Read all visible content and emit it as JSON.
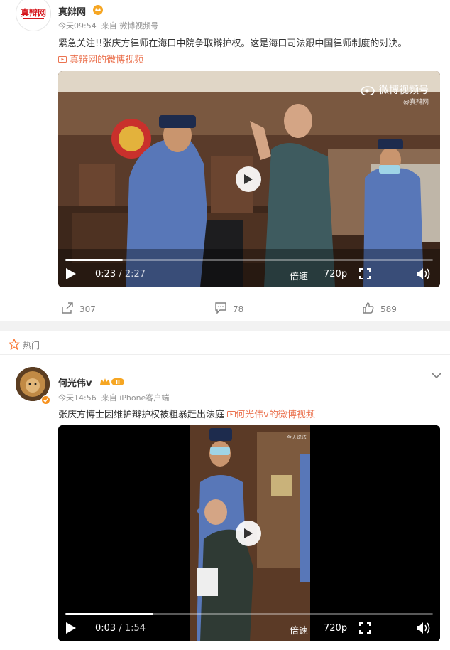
{
  "post1": {
    "author": "真辩网",
    "avatar_text": "真辩网",
    "time": "今天09:54",
    "source": "来自 微博视频号",
    "text": "紧急关注!!张庆方律师在海口中院争取辩护权。这是海口司法跟中国律师制度的对决。",
    "video_link": "真辩网的微博视频",
    "video": {
      "watermark": "微博视频号",
      "watermark_sub": "@真辩网",
      "time_current": "0:23",
      "time_total": "2:27",
      "progress": 0.156,
      "speed_label": "倍速",
      "quality_label": "720p"
    },
    "actions": {
      "repost": "307",
      "comment": "78",
      "like": "589"
    }
  },
  "post2": {
    "hot_label": "热门",
    "author": "何光伟v",
    "time": "今天14:56",
    "source": "来自 iPhone客户端",
    "text": "张庆方博士因维护辩护权被粗暴赶出法庭",
    "video_link": "何光伟v的微博视频",
    "video": {
      "watermark": "今天说法",
      "time_current": "0:03",
      "time_total": "1:54",
      "progress": 0.24,
      "speed_label": "倍速",
      "quality_label": "720p"
    }
  },
  "icons": [
    "crown-badge-icon",
    "play-icon",
    "fullscreen-icon",
    "volume-icon",
    "repost-icon",
    "comment-icon",
    "like-icon",
    "hot-icon",
    "chevron-down-icon",
    "verified-icon",
    "video-link-icon"
  ],
  "colors": {
    "link": "#eb7350",
    "hot": "#fa7d3c",
    "crown": "#f6a623"
  }
}
